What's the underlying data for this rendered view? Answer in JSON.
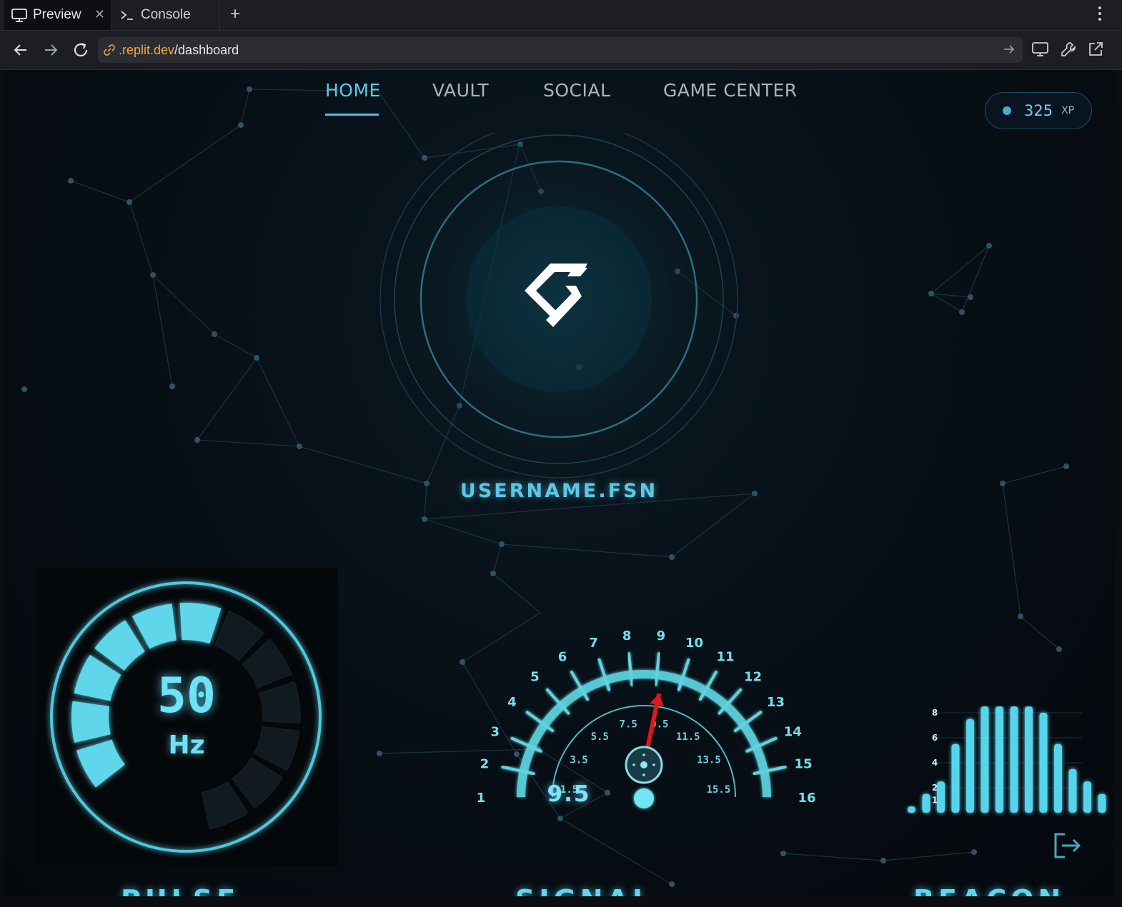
{
  "browser": {
    "tabs": [
      {
        "label": "Preview",
        "icon": "monitor-icon",
        "active": true
      },
      {
        "label": "Console",
        "icon": "terminal-icon",
        "active": false
      }
    ],
    "url_host": ".replit.dev",
    "url_path": "/dashboard"
  },
  "nav": {
    "items": [
      "HOME",
      "VAULT",
      "SOCIAL",
      "GAME CENTER"
    ],
    "active": "HOME"
  },
  "xp": {
    "value": "325",
    "unit": "XP"
  },
  "profile": {
    "username": "USERNAME.FSN",
    "logo": "fsn-logo"
  },
  "pulse": {
    "value": "50",
    "unit": "Hz",
    "label": "PULSE",
    "level_fraction": 0.5
  },
  "signal": {
    "value": "9.5",
    "label": "SIGNAL",
    "outer_ticks": [
      "1",
      "2",
      "3",
      "4",
      "5",
      "6",
      "7",
      "8",
      "9",
      "10",
      "11",
      "12",
      "13",
      "14",
      "15",
      "16"
    ],
    "inner_ticks": [
      "1.5",
      "3.5",
      "5.5",
      "7.5",
      "9.5",
      "11.5",
      "13.5",
      "15.5"
    ],
    "needle_value": 9.5
  },
  "beacon": {
    "label": "BEACON",
    "y_ticks": [
      "8",
      "6",
      "4",
      "2",
      "1"
    ],
    "bars": [
      0.5,
      1.5,
      2.5,
      5.5,
      7.5,
      8.5,
      8.5,
      8.5,
      8.5,
      8,
      5.5,
      3.5,
      2.5,
      1.5
    ]
  },
  "colors": {
    "accent": "#5cc9e8",
    "needle": "#e0161f",
    "glow": "#6fe2f5"
  }
}
